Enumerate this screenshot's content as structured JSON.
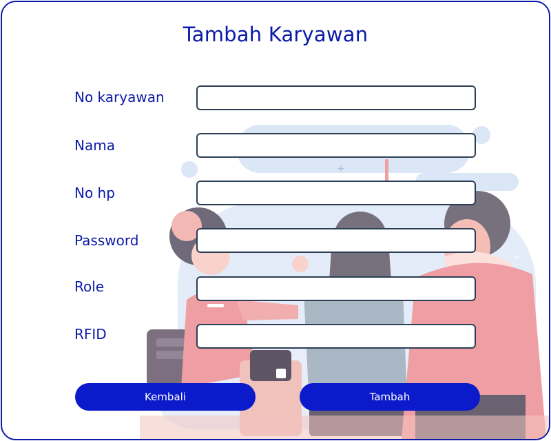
{
  "form": {
    "title": "Tambah Karyawan",
    "fields": [
      {
        "label": "No karyawan",
        "value": "",
        "placeholder": ""
      },
      {
        "label": "Nama",
        "value": "",
        "placeholder": ""
      },
      {
        "label": "No hp",
        "value": "",
        "placeholder": ""
      },
      {
        "label": "Password",
        "value": "",
        "placeholder": ""
      },
      {
        "label": "Role",
        "value": "",
        "placeholder": ""
      },
      {
        "label": "RFID",
        "value": "",
        "placeholder": ""
      }
    ],
    "buttons": {
      "back_label": "Kembali",
      "submit_label": "Tambah"
    }
  },
  "colors": {
    "primary": "#0b1acb",
    "border": "#0b1aa8",
    "input_border": "#2c3e55",
    "illustration_blue": "#dbe7f7",
    "illustration_pink": "#ee9ea2"
  }
}
